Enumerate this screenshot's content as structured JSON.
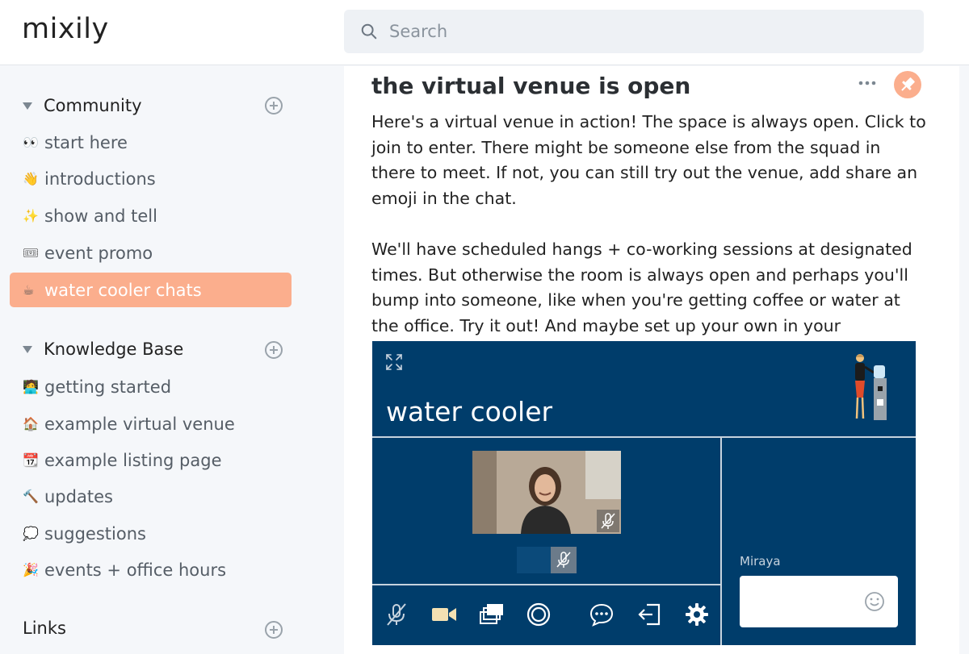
{
  "app": {
    "logo": "mixily"
  },
  "search": {
    "placeholder": "Search",
    "value": ""
  },
  "sidebar": {
    "community": {
      "title": "Community",
      "items": [
        {
          "emoji": "👀",
          "label": "start here"
        },
        {
          "emoji": "👋",
          "label": "introductions"
        },
        {
          "emoji": "✨",
          "label": "show and tell"
        },
        {
          "emoji": "🎟",
          "label": "event promo"
        },
        {
          "emoji": "☕",
          "label": "water cooler chats",
          "active": true
        }
      ]
    },
    "knowledge_base": {
      "title": "Knowledge Base",
      "items": [
        {
          "emoji": "🧑‍💻",
          "label": "getting started"
        },
        {
          "emoji": "🏠",
          "label": "example virtual venue"
        },
        {
          "emoji": "📆",
          "label": "example listing page"
        },
        {
          "emoji": "🔨",
          "label": "updates"
        },
        {
          "emoji": "💭",
          "label": "suggestions"
        },
        {
          "emoji": "🎉",
          "label": "events + office hours"
        }
      ]
    },
    "links": {
      "title": "Links"
    }
  },
  "post": {
    "title": "the virtual venue is open",
    "paragraphs": [
      "Here's a virtual venue in action! The space is always open. Click to join to enter. There might be someone else from the squad in there to meet. If not, you can still try out the venue, add share an emoji in the chat.",
      "We'll have scheduled hangs + co-working sessions at designated times. But otherwise the room is always open and perhaps you'll bump into someone, like when you're getting coffee or water at the office. Try it out! And maybe set up your own in your community."
    ]
  },
  "venue": {
    "title": "water cooler",
    "chat_name": "Miraya",
    "chat_value": "",
    "colors": {
      "background": "#003d6b",
      "accent": "#fbae8d"
    }
  }
}
